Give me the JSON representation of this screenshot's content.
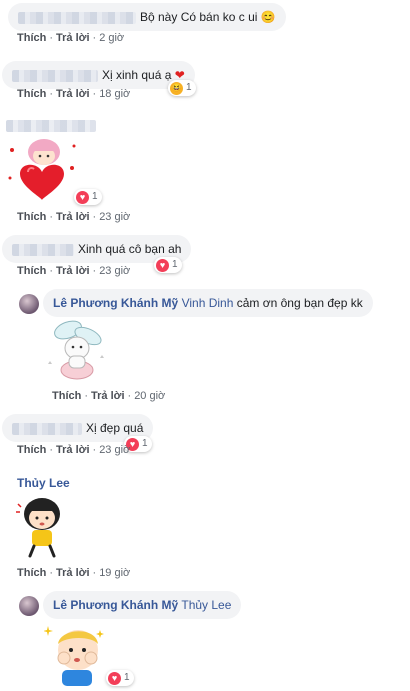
{
  "actions": {
    "like": "Thích",
    "reply": "Trả lời",
    "dot": "·"
  },
  "comments": [
    {
      "text": "Bộ này Có bán ko c ui",
      "emoji": "😊",
      "time": "2 giờ"
    },
    {
      "text": "Xị xinh quá ạ",
      "emoji": "❤️",
      "time": "18 giờ",
      "reaction_count": "1"
    },
    {
      "time": "23 giờ",
      "reaction_count": "1"
    },
    {
      "text": "Xinh quá cô bạn ah",
      "time": "23 giờ",
      "reaction_count": "1"
    },
    {
      "author": "Lê Phương Khánh Mỹ",
      "tag": "Vinh Dinh",
      "text": "cảm ơn ông bạn đẹp kk",
      "time": "20 giờ"
    },
    {
      "text": "Xị đẹp quá",
      "time": "23 giờ",
      "reaction_count": "1"
    },
    {
      "author": "Thủy Lee",
      "time": "19 giờ"
    },
    {
      "author": "Lê Phương Khánh Mỹ",
      "tag": "Thủy Lee",
      "reaction_count": "1"
    }
  ],
  "icons": {
    "heart": "heart-icon",
    "haha": "haha-icon",
    "sticker_heart_girl": "heart-girl-sticker",
    "sticker_bunny": "bunny-sticker",
    "sticker_girl": "girl-sticker",
    "sticker_boy": "blond-boy-sticker"
  },
  "colors": {
    "bubble": "#f2f3f5",
    "name": "#385898",
    "meta": "#606770",
    "heart": "#f33e58"
  }
}
